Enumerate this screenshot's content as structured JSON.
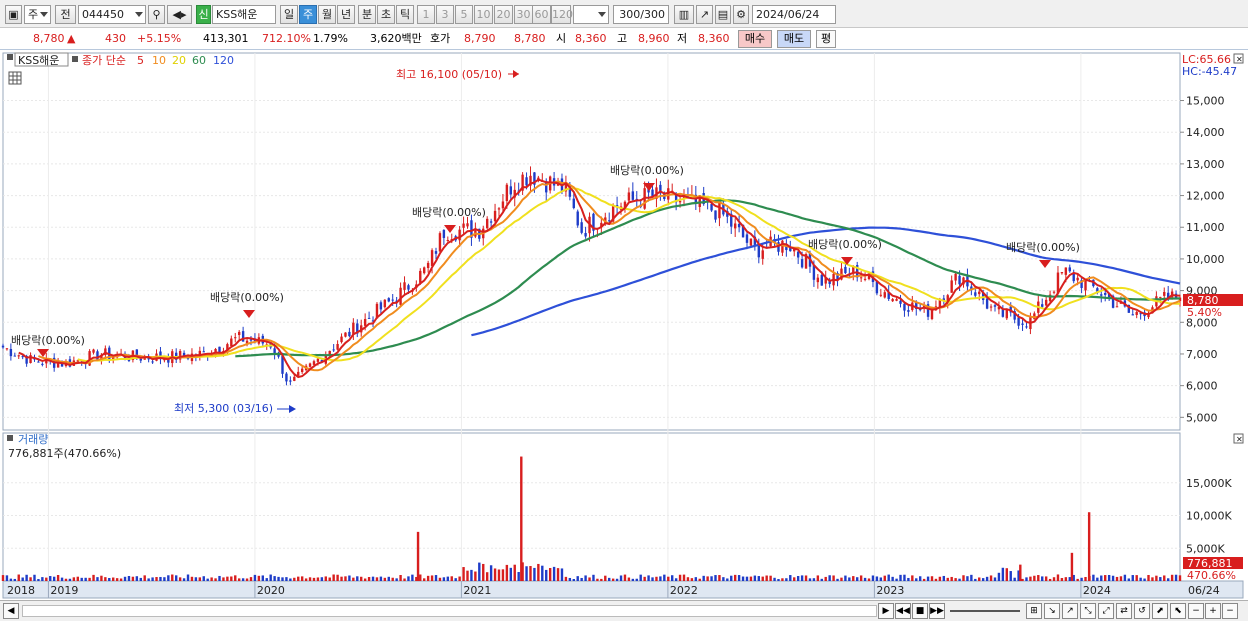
{
  "toolbar": {
    "period": "주",
    "prev": "전",
    "code": "044450",
    "badge": "신",
    "name": "KSS해운",
    "tabs": [
      "일",
      "주",
      "월",
      "년",
      "분",
      "초",
      "틱"
    ],
    "active_tab": "주",
    "intervals": [
      "1",
      "3",
      "5",
      "10",
      "20",
      "30",
      "60",
      "120"
    ],
    "count": "300",
    "count_total": "/300",
    "date": "2024/06/24"
  },
  "quote": {
    "price": "8,780",
    "arrow": "▲",
    "change": "430",
    "change_pct": "+5.15%",
    "volume": "413,301",
    "volume_ratio": "712.10%",
    "turnover": "1.79%",
    "amount": "3,620백만",
    "bid_label": "호가",
    "ask": "8,790",
    "bid": "8,780",
    "open_label": "시",
    "open": "8,360",
    "high_label": "고",
    "high": "8,960",
    "low_label": "저",
    "low": "8,360",
    "buy_label": "매수",
    "sell_label": "매도",
    "avg_label": "평"
  },
  "price_panel": {
    "name": "KSS해운",
    "ma_label": "종가 단순",
    "ma_periods": [
      "5",
      "10",
      "20",
      "60",
      "120"
    ],
    "lc": "LC:65.66",
    "hc": "HC:-45.47",
    "current": "8,780",
    "current_pct": "5.40%",
    "high_note": "최고 16,100 (05/10)",
    "low_note": "최저 5,300 (03/16)",
    "dividend": "배당락(0.00%)"
  },
  "volume_panel": {
    "title": "거래량",
    "value": "776,881주(470.66%)",
    "current": "776,881",
    "current_pct": "470.66%"
  },
  "colors": {
    "up": "#d81e1e",
    "down": "#1e3cc8",
    "ma5": "#d8201e",
    "ma10": "#f08c1e",
    "ma20": "#f0e01e",
    "ma60": "#2e8c50",
    "ma120": "#2e50d8"
  },
  "chart_data": {
    "type": "line",
    "y_ticks": [
      "15,000",
      "14,000",
      "13,000",
      "12,000",
      "11,000",
      "10,000",
      "9,000",
      "8,000",
      "7,000",
      "6,000",
      "5,000"
    ],
    "x_labels": [
      "2018",
      "2019",
      "2020",
      "2021",
      "2022",
      "2023",
      "2024",
      "06/24"
    ],
    "vol_ticks": [
      "15,000K",
      "10,000K",
      "5,000K"
    ],
    "ylim": [
      4600,
      16500
    ],
    "close": [
      [
        "2018-10",
        7300
      ],
      [
        "2018-12",
        6800
      ],
      [
        "2019-02",
        6700
      ],
      [
        "2019-04",
        7000
      ],
      [
        "2019-06",
        6900
      ],
      [
        "2019-08",
        6900
      ],
      [
        "2019-10",
        7000
      ],
      [
        "2019-12",
        7500
      ],
      [
        "2020-02",
        7300
      ],
      [
        "2020-03",
        6000
      ],
      [
        "2020-05",
        7000
      ],
      [
        "2020-07",
        7900
      ],
      [
        "2020-09",
        8700
      ],
      [
        "2020-11",
        9700
      ],
      [
        "2020-12",
        10900
      ],
      [
        "2021-02",
        10900
      ],
      [
        "2021-04",
        12400
      ],
      [
        "2021-05",
        12700
      ],
      [
        "2021-07",
        12200
      ],
      [
        "2021-08",
        10900
      ],
      [
        "2021-10",
        11700
      ],
      [
        "2021-12",
        12000
      ],
      [
        "2022-02",
        11800
      ],
      [
        "2022-04",
        11500
      ],
      [
        "2022-06",
        10300
      ],
      [
        "2022-08",
        10500
      ],
      [
        "2022-10",
        9300
      ],
      [
        "2022-12",
        9600
      ],
      [
        "2023-02",
        8800
      ],
      [
        "2023-04",
        8300
      ],
      [
        "2023-06",
        9500
      ],
      [
        "2023-08",
        8300
      ],
      [
        "2023-10",
        8000
      ],
      [
        "2023-12",
        9600
      ],
      [
        "2024-02",
        9000
      ],
      [
        "2024-04",
        8200
      ],
      [
        "2024-06",
        8780
      ]
    ],
    "series": [
      {
        "name": "5"
      },
      {
        "name": "10"
      },
      {
        "name": "20"
      },
      {
        "name": "60"
      },
      {
        "name": "120"
      }
    ]
  }
}
